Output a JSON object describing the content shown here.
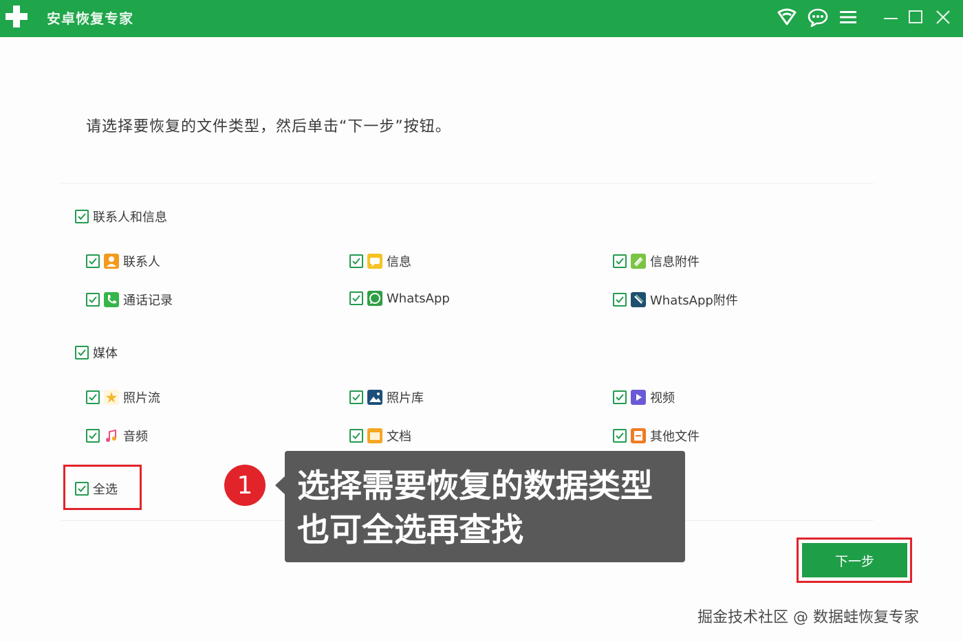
{
  "window": {
    "title": "安卓恢复专家",
    "accent_color": "#1fa54a",
    "toolbar_icons": [
      "wifi-icon",
      "chat-icon",
      "menu-icon"
    ],
    "window_controls": [
      "minimize-icon",
      "maximize-icon",
      "close-icon"
    ]
  },
  "instruction": "请选择要恢复的文件类型，然后单击“下一步”按钮。",
  "groups": [
    {
      "label": "联系人和信息",
      "checked": true,
      "items": [
        {
          "label": "联系人",
          "checked": true,
          "icon": "contact-icon",
          "color": "#f39a1e"
        },
        {
          "label": "信息",
          "checked": true,
          "icon": "message-icon",
          "color": "#f5c325"
        },
        {
          "label": "信息附件",
          "checked": true,
          "icon": "attachment-icon",
          "color": "#7cc444"
        },
        {
          "label": "通话记录",
          "checked": true,
          "icon": "phone-icon",
          "color": "#36b54a"
        },
        {
          "label": "WhatsApp",
          "checked": true,
          "icon": "whatsapp-icon",
          "color": "#2f9e44"
        },
        {
          "label": "WhatsApp附件",
          "checked": true,
          "icon": "whatsapp-attachment-icon",
          "color": "#1f4f6f"
        }
      ]
    },
    {
      "label": "媒体",
      "checked": true,
      "items": [
        {
          "label": "照片流",
          "checked": true,
          "icon": "photostream-icon",
          "color": "#f5b82e"
        },
        {
          "label": "照片库",
          "checked": true,
          "icon": "photo-library-icon",
          "color": "#1d4f7a"
        },
        {
          "label": "视频",
          "checked": true,
          "icon": "video-icon",
          "color": "#6a5ad6"
        },
        {
          "label": "音频",
          "checked": true,
          "icon": "audio-icon",
          "color": "#e8527a"
        },
        {
          "label": "文档",
          "checked": true,
          "icon": "document-icon",
          "color": "#f5a623"
        },
        {
          "label": "其他文件",
          "checked": true,
          "icon": "other-files-icon",
          "color": "#f07b24"
        }
      ]
    }
  ],
  "select_all": {
    "label": "全选",
    "checked": true
  },
  "callout": {
    "number": "1",
    "line1": "选择需要恢复的数据类型",
    "line2": "也可全选再查找"
  },
  "next_button": "下一步",
  "watermark": "掘金技术社区 @ 数据蛙恢复专家"
}
